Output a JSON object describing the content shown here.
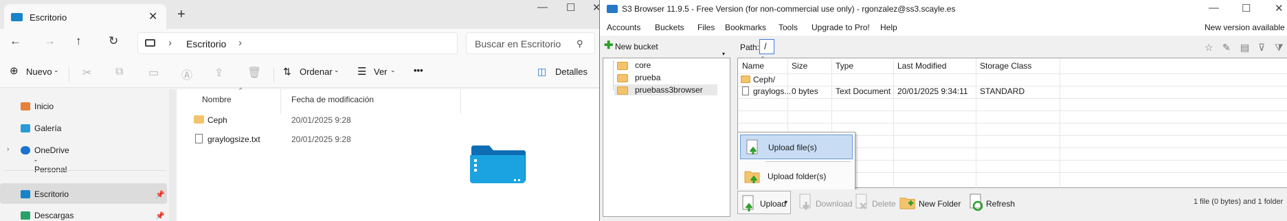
{
  "explorer": {
    "tab_title": "Escritorio",
    "new_tab": "+",
    "close_tab": "✕",
    "window_controls": [
      "—",
      "☐",
      "✕"
    ],
    "breadcrumb": "Escritorio",
    "search_placeholder": "Buscar en Escritorio",
    "toolbar": {
      "new_label": "Nuevo",
      "sort_label": "Ordenar",
      "view_label": "Ver",
      "more_label": "•••",
      "details_label": "Detalles"
    },
    "nav_items": [
      {
        "label": "Inicio",
        "icon": "home-icon",
        "color": "#e8803a"
      },
      {
        "label": "Galería",
        "icon": "gallery-icon",
        "color": "#2a9bd8"
      },
      {
        "label": "OneDrive - Personal",
        "icon": "cloud-icon",
        "color": "#1a73d1"
      },
      {
        "label": "Escritorio",
        "icon": "desktop-icon",
        "color": "#1883c9"
      },
      {
        "label": "Descargas",
        "icon": "download-icon",
        "color": "#2aa06a"
      }
    ],
    "columns": {
      "name": "Nombre",
      "date": "Fecha de modificación"
    },
    "files": [
      {
        "name": "Ceph",
        "date": "20/01/2025 9:28",
        "icon": "folder-icon"
      },
      {
        "name": "graylogsize.txt",
        "date": "20/01/2025 9:28",
        "icon": "text-file-icon"
      }
    ]
  },
  "s3": {
    "title": "S3 Browser 11.9.5 - Free Version (for non-commercial use only) - rgonzalez@ss3.scayle.es",
    "menu": [
      "Accounts",
      "Buckets",
      "Files",
      "Bookmarks",
      "Tools",
      "Upgrade to Pro!",
      "Help"
    ],
    "new_version": "New version available",
    "new_bucket": "New bucket",
    "buckets": [
      "core",
      "prueba",
      "pruebass3browser"
    ],
    "path_label": "Path:",
    "path_value": "/",
    "columns": [
      "Name",
      "Size",
      "Type",
      "Last Modified",
      "Storage Class"
    ],
    "files": [
      {
        "name": "Ceph/",
        "size": "",
        "type": "",
        "modified": "",
        "storage": ""
      },
      {
        "name": "graylogs...",
        "size": "0 bytes",
        "type": "Text Document",
        "modified": "20/01/2025 9:34:11",
        "storage": "STANDARD"
      }
    ],
    "popup": {
      "upload_files": "Upload file(s)",
      "upload_folder": "Upload folder(s)"
    },
    "bottom": {
      "upload": "Upload",
      "download": "Download",
      "delete": "Delete",
      "new_folder": "New Folder",
      "refresh": "Refresh",
      "status": "1 file (0 bytes) and 1 folder"
    }
  }
}
